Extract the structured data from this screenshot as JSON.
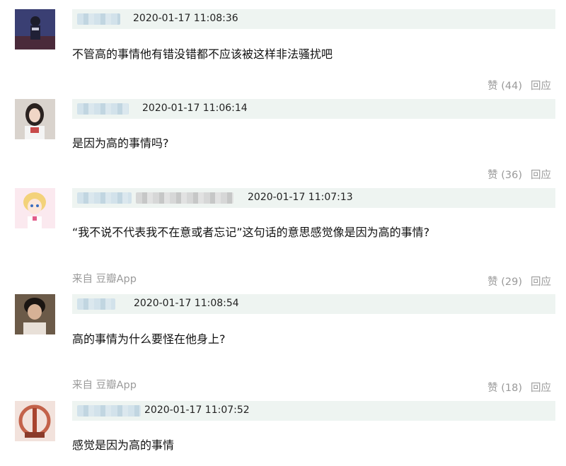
{
  "comments": [
    {
      "time": "2020-01-17 11:08:36",
      "text": "不管高的事情他有错没错都不应该被这样非法骚扰吧",
      "like_label": "赞 (44)",
      "reply_label": "回应"
    },
    {
      "time": "2020-01-17 11:06:14",
      "text": "是因为高的事情吗?",
      "like_label": "赞 (36)",
      "reply_label": "回应"
    },
    {
      "time": "2020-01-17 11:07:13",
      "text": "“我不说不代表我不在意或者忘记”这句话的意思感觉像是因为高的事情?",
      "source": "来自 豆瓣App",
      "like_label": "赞 (29)",
      "reply_label": "回应"
    },
    {
      "time": "2020-01-17 11:08:54",
      "text": "高的事情为什么要怪在他身上?",
      "source": "来自 豆瓣App",
      "like_label": "赞 (18)",
      "reply_label": "回应"
    },
    {
      "time": "2020-01-17 11:07:52",
      "text": "感觉是因为高的事情"
    }
  ]
}
